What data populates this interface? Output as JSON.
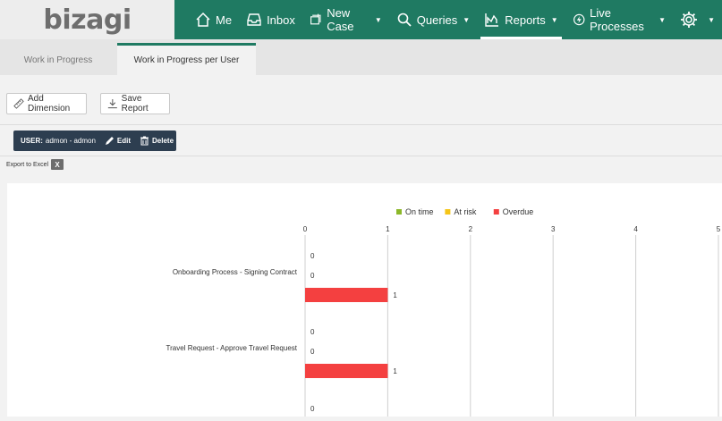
{
  "app": {
    "logo_text": "bizagi"
  },
  "nav": {
    "items": [
      {
        "label": "Me",
        "icon": "home-icon"
      },
      {
        "label": "Inbox",
        "icon": "inbox-icon"
      },
      {
        "label": "New Case",
        "icon": "new-case-icon"
      },
      {
        "label": "Queries",
        "icon": "search-icon"
      },
      {
        "label": "Reports",
        "icon": "reports-icon"
      },
      {
        "label": "Live Processes",
        "icon": "live-processes-icon"
      }
    ],
    "active": "Reports",
    "settings_icon": "gear-icon"
  },
  "tabs": [
    {
      "label": "Work in Progress"
    },
    {
      "label": "Work in Progress per User"
    }
  ],
  "toolbar": {
    "add_dimension_label": "Add Dimension",
    "save_report_label": "Save Report"
  },
  "filter": {
    "key": "USER:",
    "value": "admon - admon",
    "edit_label": "Edit",
    "delete_label": "Delete"
  },
  "export_label": "Export to Excel",
  "colors": {
    "brand": "#1f7a62",
    "on_time": "#8cb82a",
    "at_risk": "#f5c518",
    "overdue": "#f44040",
    "pill": "#2d3e50"
  },
  "chart_data": {
    "type": "bar",
    "orientation": "horizontal",
    "legend": [
      "On time",
      "At risk",
      "Overdue"
    ],
    "legend_placement": "top",
    "xlim": [
      0,
      5
    ],
    "x_ticks": [
      "0",
      "1",
      "2",
      "3",
      "4",
      "5"
    ],
    "grid": true,
    "categories": [
      "Onboarding Process - Signing Contract",
      "Travel Request - Approve Travel Request"
    ],
    "series": [
      {
        "name": "On time",
        "values": [
          0,
          0
        ]
      },
      {
        "name": "At risk",
        "values": [
          0,
          0
        ]
      },
      {
        "name": "Overdue",
        "values": [
          1,
          1
        ]
      }
    ],
    "extra_value_labels": [
      "0"
    ]
  }
}
